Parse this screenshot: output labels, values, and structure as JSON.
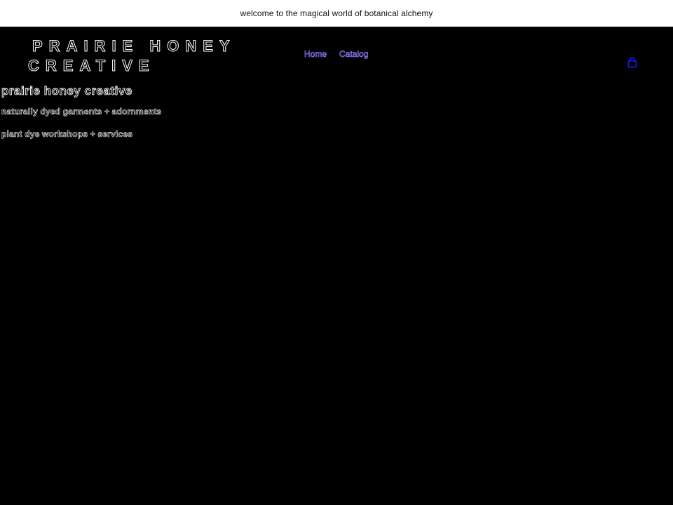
{
  "announcement": {
    "text": "welcome to the magical world of botanical alchemy"
  },
  "header": {
    "logo_line1": "PRAIRIE HONEY",
    "logo_line2": "CREATIVE",
    "nav": [
      {
        "label": "Home"
      },
      {
        "label": "Catalog"
      }
    ],
    "cart_icon": "shopping-bag-icon"
  },
  "main": {
    "heading": "prairie honey creative",
    "lines": [
      "naturally dyed garments + adornments",
      "plant dye workshops + services"
    ]
  },
  "colors": {
    "background": "#000000",
    "announcement_bg": "#ffffff",
    "nav_link": "#8a7dff",
    "cart_icon": "#1a1aff"
  }
}
